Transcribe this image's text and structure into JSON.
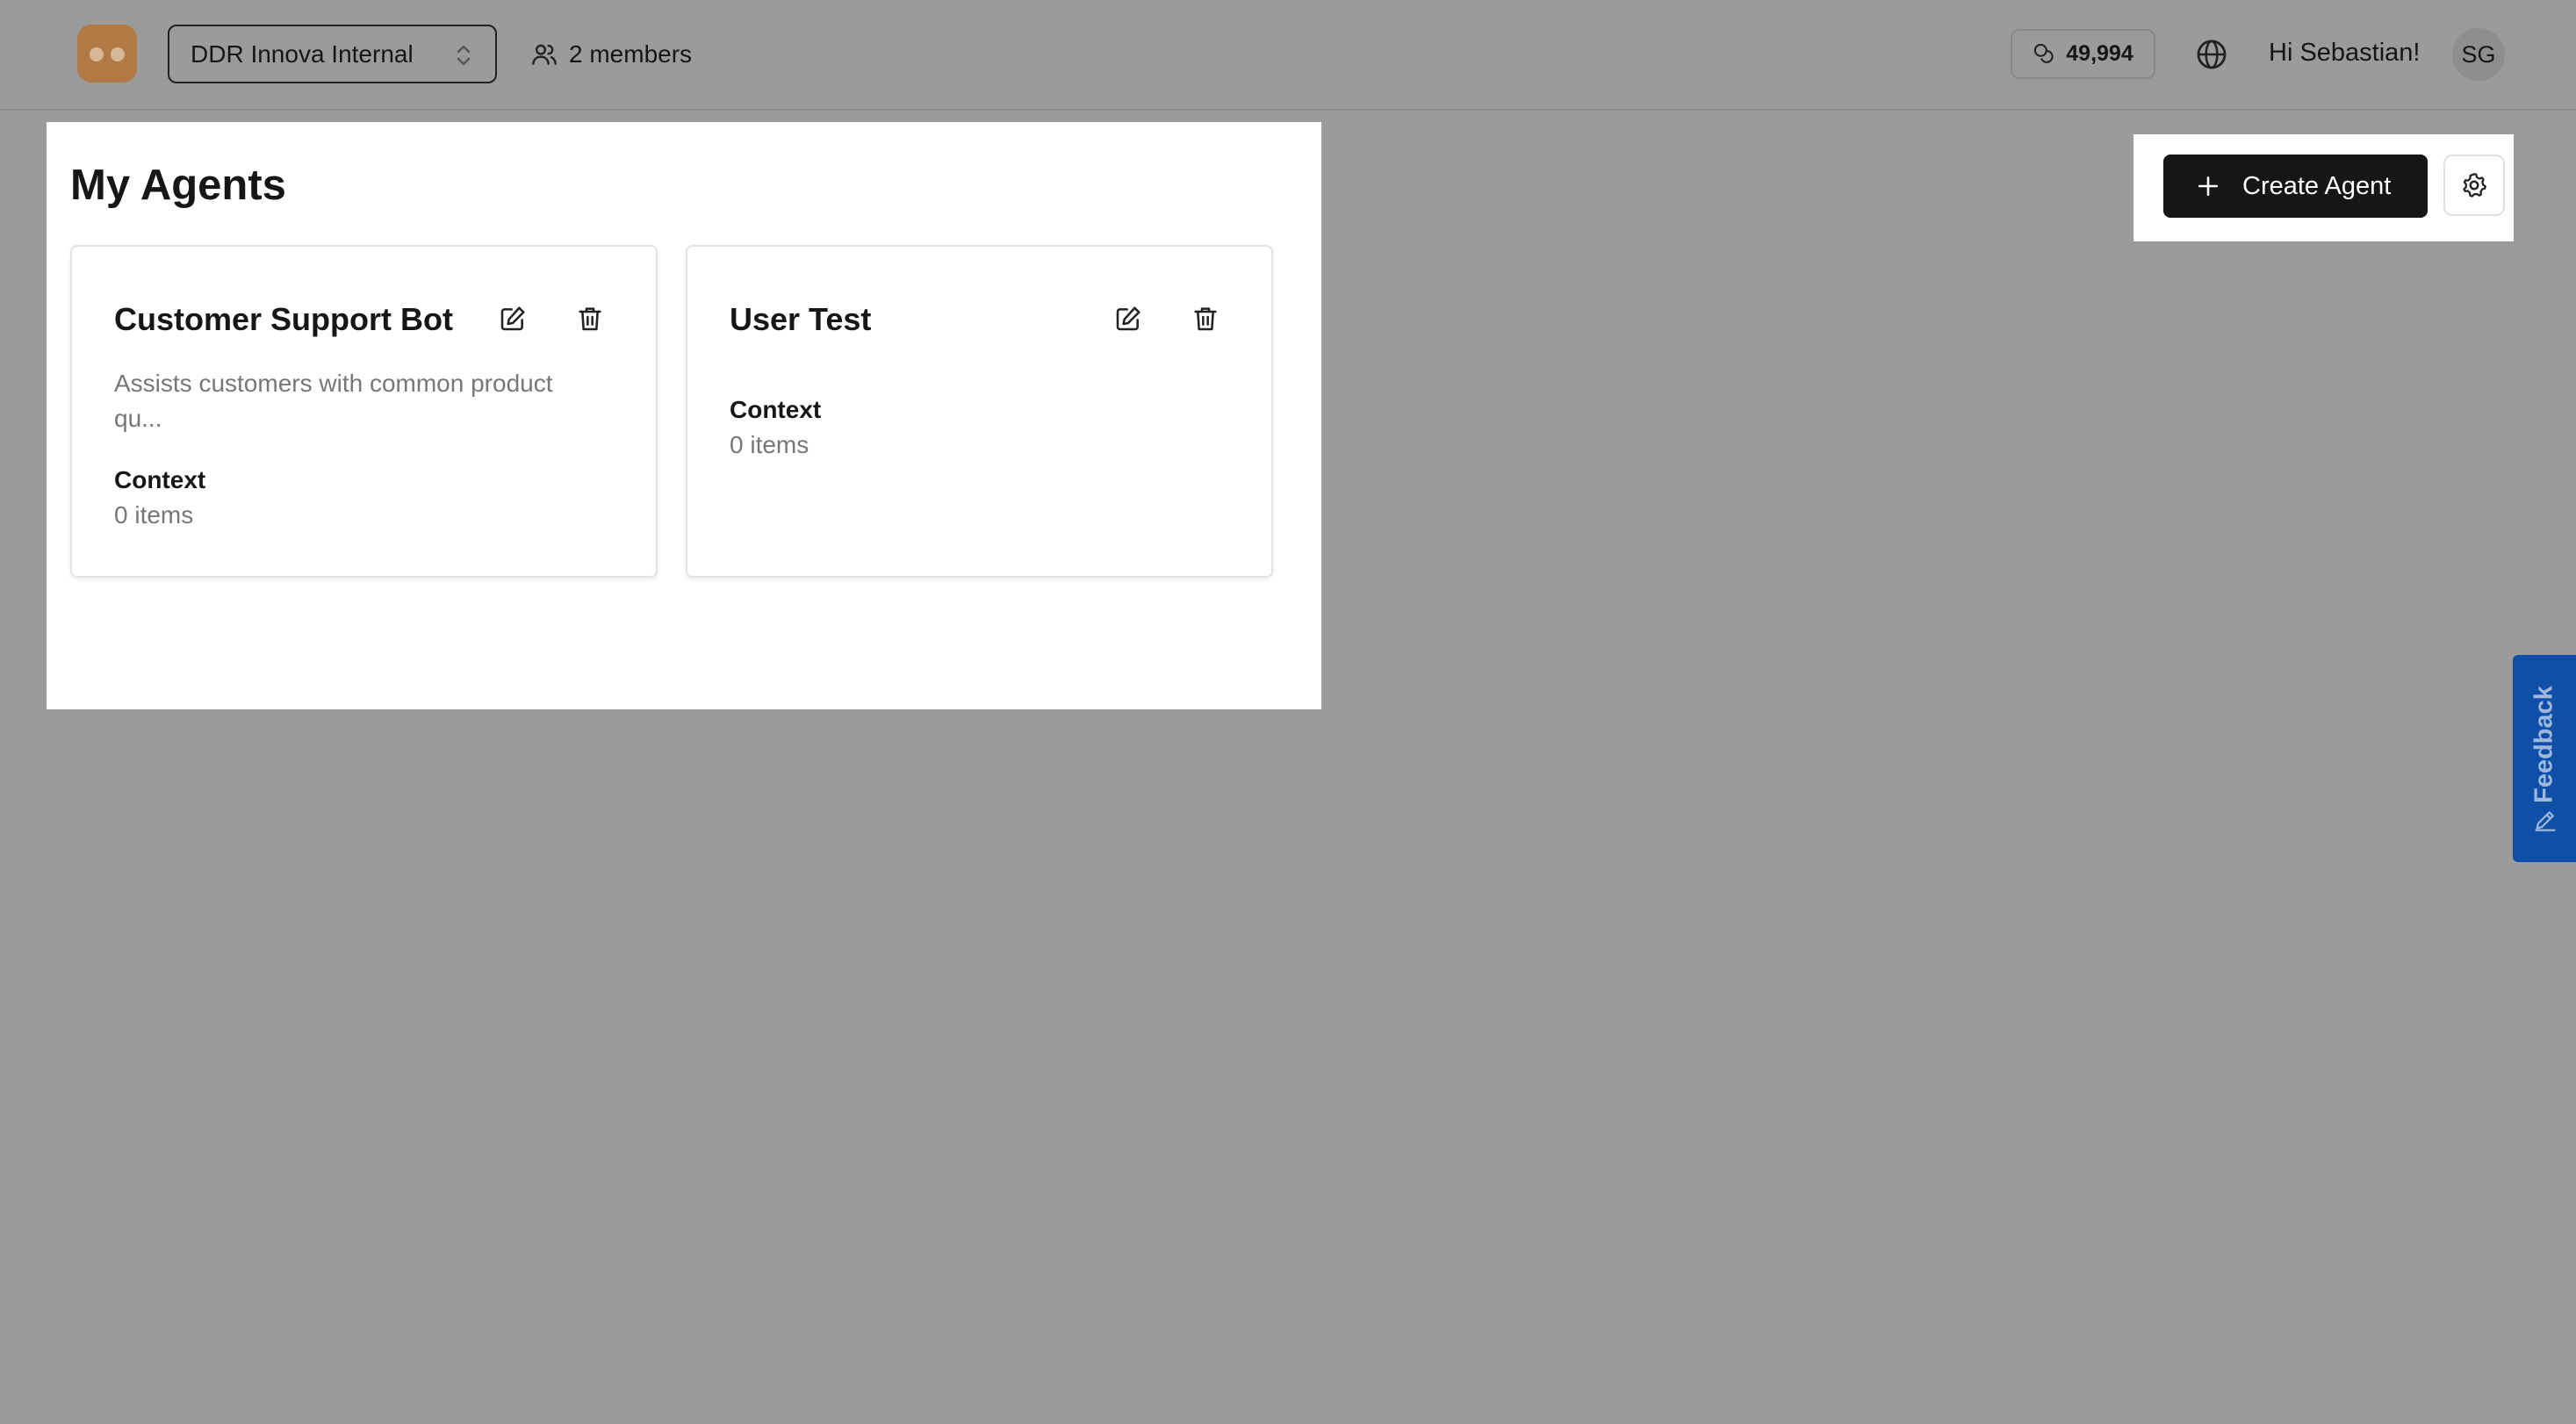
{
  "header": {
    "workspace_name": "DDR Innova Internal",
    "members_label": "2 members",
    "credits": "49,994",
    "greeting": "Hi Sebastian!",
    "avatar_initials": "SG"
  },
  "main": {
    "title": "My Agents",
    "create_button_label": "Create Agent",
    "agents": [
      {
        "name": "Customer Support Bot",
        "description": "Assists customers with common product qu...",
        "context_label": "Context",
        "context_value": "0 items"
      },
      {
        "name": "User Test",
        "description": "",
        "context_label": "Context",
        "context_value": "0 items"
      }
    ]
  },
  "feedback": {
    "label": "Feedback"
  },
  "colors": {
    "overlay": "#9b9b9b",
    "primary_button": "#161616",
    "feedback_tab": "#0f4fa8",
    "logo": "#b07a45"
  },
  "icons": [
    "users-icon",
    "coins-icon",
    "globe-icon",
    "plus-icon",
    "gear-icon",
    "edit-icon",
    "trash-icon",
    "pencil-icon",
    "chevron-up-down-icon"
  ]
}
